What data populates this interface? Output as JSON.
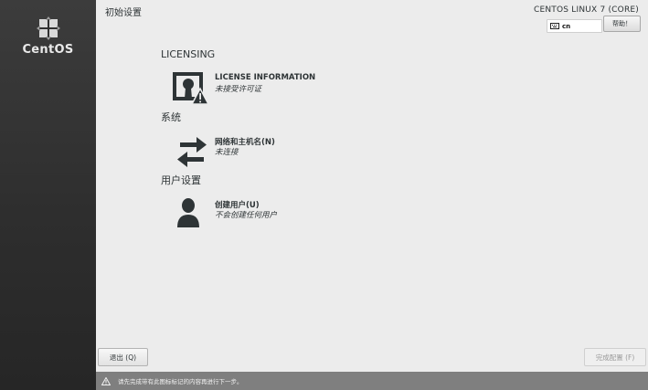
{
  "sidebar": {
    "brand_name": "CentOS"
  },
  "header": {
    "page_title": "初始设置",
    "product_title": "CENTOS LINUX 7 (CORE)",
    "keyboard_layout": "cn",
    "help_label": "帮助！"
  },
  "sections": [
    {
      "header": "LICENSING",
      "spokes": [
        {
          "title": "LICENSE INFORMATION",
          "status": "未接受许可证",
          "icon": "license-warning-icon"
        }
      ]
    },
    {
      "header": "系统",
      "spokes": [
        {
          "title": "网络和主机名(N)",
          "status": "未连接",
          "icon": "network-arrows-icon"
        }
      ]
    },
    {
      "header": "用户设置",
      "spokes": [
        {
          "title": "创建用户(U)",
          "status": "不会创建任何用户",
          "icon": "user-icon"
        }
      ]
    }
  ],
  "footer": {
    "quit_label": "退出 (Q)",
    "finish_label": "完成配置 (F)",
    "warning_text": "请先完成带有此图标标记的内容再进行下一步。",
    "warning_icon": "warning-triangle-icon"
  }
}
